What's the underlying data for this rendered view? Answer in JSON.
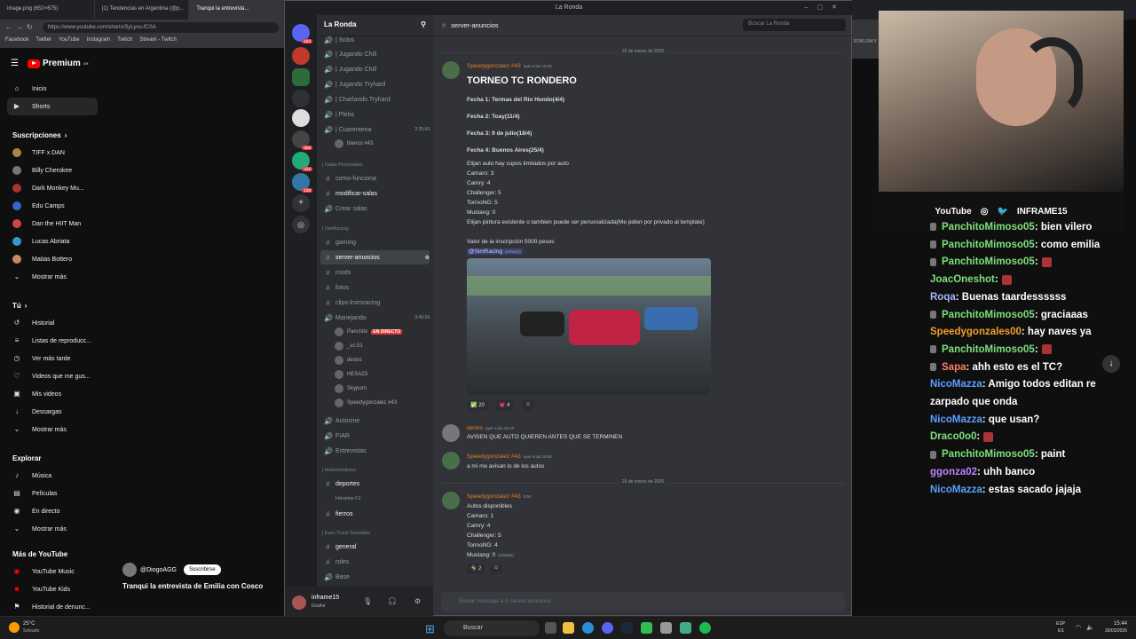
{
  "browser": {
    "tabs": [
      "image.png (652×675)",
      "(1) Tendencias en Argentina (@p...",
      "Tranqui la entrevista..."
    ],
    "url": "https://www.youtube.com/shorts/SyLyvu-fCSA",
    "bookmarks": [
      "Facebook",
      "Twitter",
      "YouTube",
      "Instagram",
      "Twitch",
      "Stream - Twitch"
    ],
    "right_bookmark": "RTAS RIKY"
  },
  "youtube": {
    "logo": "Premium",
    "country": "AR",
    "nav": [
      {
        "label": "Inicio",
        "icon": "home-icon"
      },
      {
        "label": "Shorts",
        "icon": "shorts-icon"
      }
    ],
    "subs_title": "Suscripciones",
    "subs": [
      "TIFF x DAN",
      "Billy Cherokee",
      "Dark Monkey Mu...",
      "Edu Camps",
      "Dan the HIIT Man",
      "Lucas Abriata",
      "Matias Bottero",
      "Mostrar más"
    ],
    "you_title": "Tú",
    "you_items": [
      "Historial",
      "Listas de reproducc...",
      "Ver más tarde",
      "Videos que me gus...",
      "Mis videos",
      "Descargas",
      "Mostrar más"
    ],
    "explore_title": "Explorar",
    "explore_items": [
      "Música",
      "Películas",
      "En directo",
      "Mostrar más"
    ],
    "more_title": "Más de YouTube",
    "more_items": [
      "YouTube Music",
      "YouTube Kids"
    ],
    "more_bottom": "Historial de denunc...",
    "short": {
      "channel": "@DiogoAGG",
      "subscribe": "Suscribirse",
      "title": "Tranqui la entrevista de Emilia con Cosco"
    }
  },
  "discord": {
    "window_title": "La Ronda",
    "server_badges": [
      "164",
      "386",
      "413",
      "128"
    ],
    "guild": "La Ronda",
    "channels_top": [
      "| Solos",
      "| Jugando Chill",
      "| Jugando Chill",
      "| Jugando Tryhard",
      "| Charlando Tryhard",
      "| Plebs",
      "| Cuarentena"
    ],
    "cuarentena_time": "2:25:43",
    "cuarentena_user": "blanco #43",
    "cat_salas": "| Salas Personales",
    "salas": [
      "como-funciona",
      "modificar-salas",
      "Crear salas"
    ],
    "cat_sim": "| SimRacing",
    "sim_channels": [
      "gaming",
      "server-anuncios",
      "mods",
      "fotos",
      "clips-lrsimracing",
      "Manejando"
    ],
    "manejando_time": "3:49:34",
    "voice_users": [
      "Panchito",
      "_sc.01",
      "destro",
      "HESA23",
      "Skyporn",
      "Speedygonzalez #43"
    ],
    "live_label": "EN DIRECTO",
    "more_channels": [
      "Autocine",
      "FIAR",
      "Entrevistas"
    ],
    "cat_auto": "| Automovilismo",
    "auto_channels": [
      "deportes",
      "Horarios F1",
      "fierros"
    ],
    "cat_euro": "| Euro Truck Simulator",
    "euro_channels": [
      "general",
      "roles",
      "Base"
    ],
    "user": {
      "name": "inframe15",
      "status": "Ekathé"
    },
    "chat_channel": "server-anuncios",
    "search": "Buscar La Ronda",
    "date1": "25 de marzo de 2026",
    "post": {
      "author": "Speedygonzalez #43",
      "time": "ayer a las 16:03",
      "title": "TORNEO TC RONDERO",
      "fechas": [
        "Fecha 1: Termas del Rio Hondo(4/4)",
        "Fecha 2: Toay(11/4)",
        "Fecha 3: 9 de julio(18/4)",
        "Fecha 4: Buenos Aires(25/4)"
      ],
      "body": [
        "Elijan auto hay cupos limitados por auto",
        "Camaro: 3",
        "Camry: 4",
        "Challenger: 5",
        "TorinoNG: 5",
        "Mustang: 0",
        "Elijan pintura existente o tambien puede ser personalizada(Me piden por privado al template)"
      ],
      "price": "Valor de la inscripción 5000 pesos",
      "mention": "@SimRacing",
      "edited": "(editado)",
      "reactions": [
        "20",
        "4"
      ]
    },
    "msg2": {
      "author": "destro",
      "time": "ayer a las 16:13",
      "text": "AVISEN QUE AUTO QUIEREN ANTES QUE SE TERMINEN"
    },
    "msg3": {
      "author": "Speedygonzalez #43",
      "time": "ayer a las 16:53",
      "text": "a mi me avisan lo de los autos"
    },
    "date2": "26 de marzo de 2026",
    "msg4": {
      "author": "Speedygonzalez #43",
      "time": "0:50",
      "lines": [
        "Autos disponibles",
        "Camaro: 1",
        "Camry: 4",
        "Challenger: 5",
        "TorinoNG: 4",
        "Mustang: 0"
      ],
      "edited": "(editado)",
      "reaction": "2"
    },
    "composer": "Enviar mensaje a #  server-anuncios"
  },
  "stream": {
    "social_youtube": "YouTube",
    "handle": "INFRAME15",
    "chat": [
      {
        "user": "PanchitoMimoso05",
        "text": ": bien vilero",
        "color": "#7ee07e",
        "badge": true
      },
      {
        "user": "PanchitoMimoso05",
        "text": ": como emilia",
        "color": "#7ee07e",
        "badge": true
      },
      {
        "user": "PanchitoMimoso05",
        "text": ":",
        "color": "#7ee07e",
        "badge": true,
        "emote": true
      },
      {
        "user": "JoacOneshot",
        "text": ":",
        "color": "#7ee07e",
        "badge": false,
        "emote": true
      },
      {
        "user": "Roqa",
        "text": ": Buenas taardessssss",
        "color": "#a0b6ff",
        "badge": false
      },
      {
        "user": "PanchitoMimoso05",
        "text": ": graciaaas",
        "color": "#7ee07e",
        "badge": true
      },
      {
        "user": "Speedygonzales00",
        "text": ": hay naves ya",
        "color": "#f0a030",
        "badge": false
      },
      {
        "user": "PanchitoMimoso05",
        "text": ":",
        "color": "#7ee07e",
        "badge": true,
        "emote": true
      },
      {
        "user": "Sapa",
        "text": ": ahh esto es el TC?",
        "color": "#ff8060",
        "badge": true
      },
      {
        "user": "NicoMazza",
        "text": ": Amigo todos editan re",
        "color": "#5aa0ff",
        "badge": false
      },
      {
        "user": "",
        "text": "zarpado que onda",
        "color": "#fff",
        "badge": false
      },
      {
        "user": "NicoMazza",
        "text": ": que usan?",
        "color": "#5aa0ff",
        "badge": false
      },
      {
        "user": "Draco0o0",
        "text": ":",
        "color": "#7ee07e",
        "badge": false,
        "emote": true
      },
      {
        "user": "PanchitoMimoso05",
        "text": ": paint",
        "color": "#7ee07e",
        "badge": true
      },
      {
        "user": "ggonza02",
        "text": ": uhh banco",
        "color": "#c080ff",
        "badge": false
      },
      {
        "user": "NicoMazza",
        "text": ": estas sacado jajaja",
        "color": "#5aa0ff",
        "badge": false
      }
    ]
  },
  "taskbar": {
    "weather_temp": "25°C",
    "weather_text": "Soleado",
    "search": "Buscar",
    "lang": "ESP",
    "lang2": "ES",
    "time": "15:44",
    "date": "26/03/2026"
  }
}
